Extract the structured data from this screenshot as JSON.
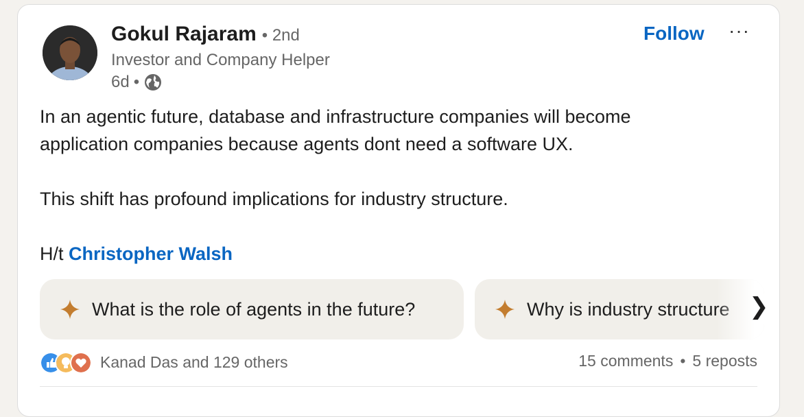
{
  "author": {
    "name": "Gokul Rajaram",
    "degree": "2nd",
    "headline": "Investor and Company Helper",
    "time": "6d",
    "bullet": "•",
    "avatar_icon": "avatar-photo"
  },
  "actions": {
    "follow_label": "Follow",
    "more_label": "···"
  },
  "post": {
    "line1": "In an agentic future, database and infrastructure companies will become",
    "line2": "application companies because agents dont need a software UX.",
    "line3": "This shift has profound implications for industry structure.",
    "ht_prefix": "H/t ",
    "mention": "Christopher Walsh"
  },
  "suggestions": [
    {
      "label": "What is the role of agents in the future?"
    },
    {
      "label": "Why is industry structure"
    }
  ],
  "suggestion_chevron": "❯",
  "social": {
    "reactions_label": "Kanad Das and 129 others",
    "comments": "15 comments",
    "reposts": "5 reposts",
    "separator": "•"
  },
  "colors": {
    "link": "#0a66c2",
    "spark": "#c37d2f",
    "like": "#378fe9",
    "insight": "#f5bb5c",
    "love": "#df704d"
  }
}
